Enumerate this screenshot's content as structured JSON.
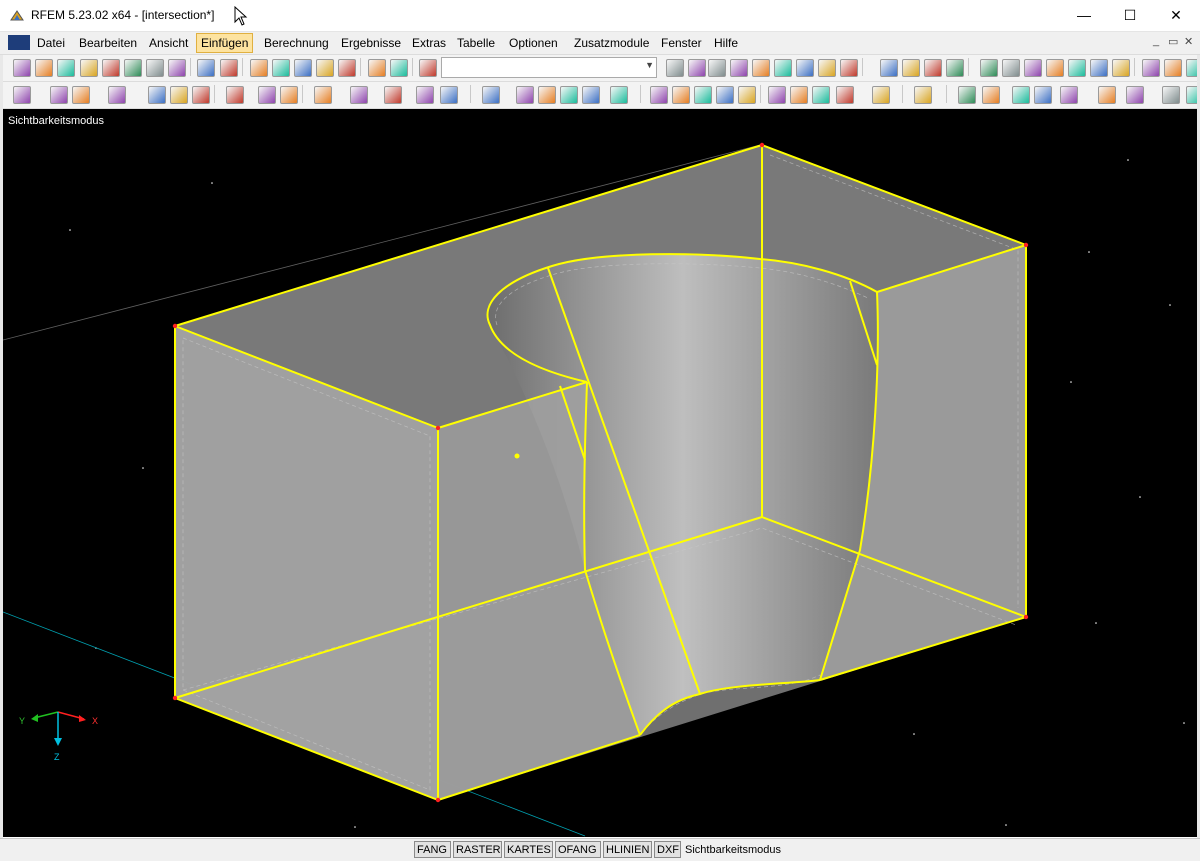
{
  "window": {
    "title": "RFEM 5.23.02 x64 - [intersection*]",
    "minimize_glyph": "—",
    "maximize_glyph": "☐",
    "close_glyph": "✕"
  },
  "menubar": {
    "items": [
      {
        "label": "Datei"
      },
      {
        "label": "Bearbeiten"
      },
      {
        "label": "Ansicht"
      },
      {
        "label": "Einfügen",
        "active": true
      },
      {
        "label": "Berechnung"
      },
      {
        "label": "Ergebnisse"
      },
      {
        "label": "Extras"
      },
      {
        "label": "Tabelle"
      },
      {
        "label": "Optionen"
      },
      {
        "label": "Zusatzmodule"
      },
      {
        "label": "Fenster"
      },
      {
        "label": "Hilfe"
      }
    ],
    "mdi_controls": [
      "_",
      "▭",
      "✕"
    ]
  },
  "toolbar": {
    "combo_value": ""
  },
  "viewport": {
    "mode_label": "Sichtbarkeitsmodus",
    "axes": {
      "x": "X",
      "y": "Y",
      "z": "Z"
    },
    "colors": {
      "background": "#000000",
      "edges": "#ffff00",
      "nodes": "#ff0000",
      "surface": "#9a9a9a",
      "grid_line": "#00a0b0"
    }
  },
  "statusbar": {
    "buttons": [
      "FANG",
      "RASTER",
      "KARTES",
      "OFANG",
      "HLINIEN",
      "DXF"
    ],
    "mode_text": "Sichtbarkeitsmodus"
  }
}
